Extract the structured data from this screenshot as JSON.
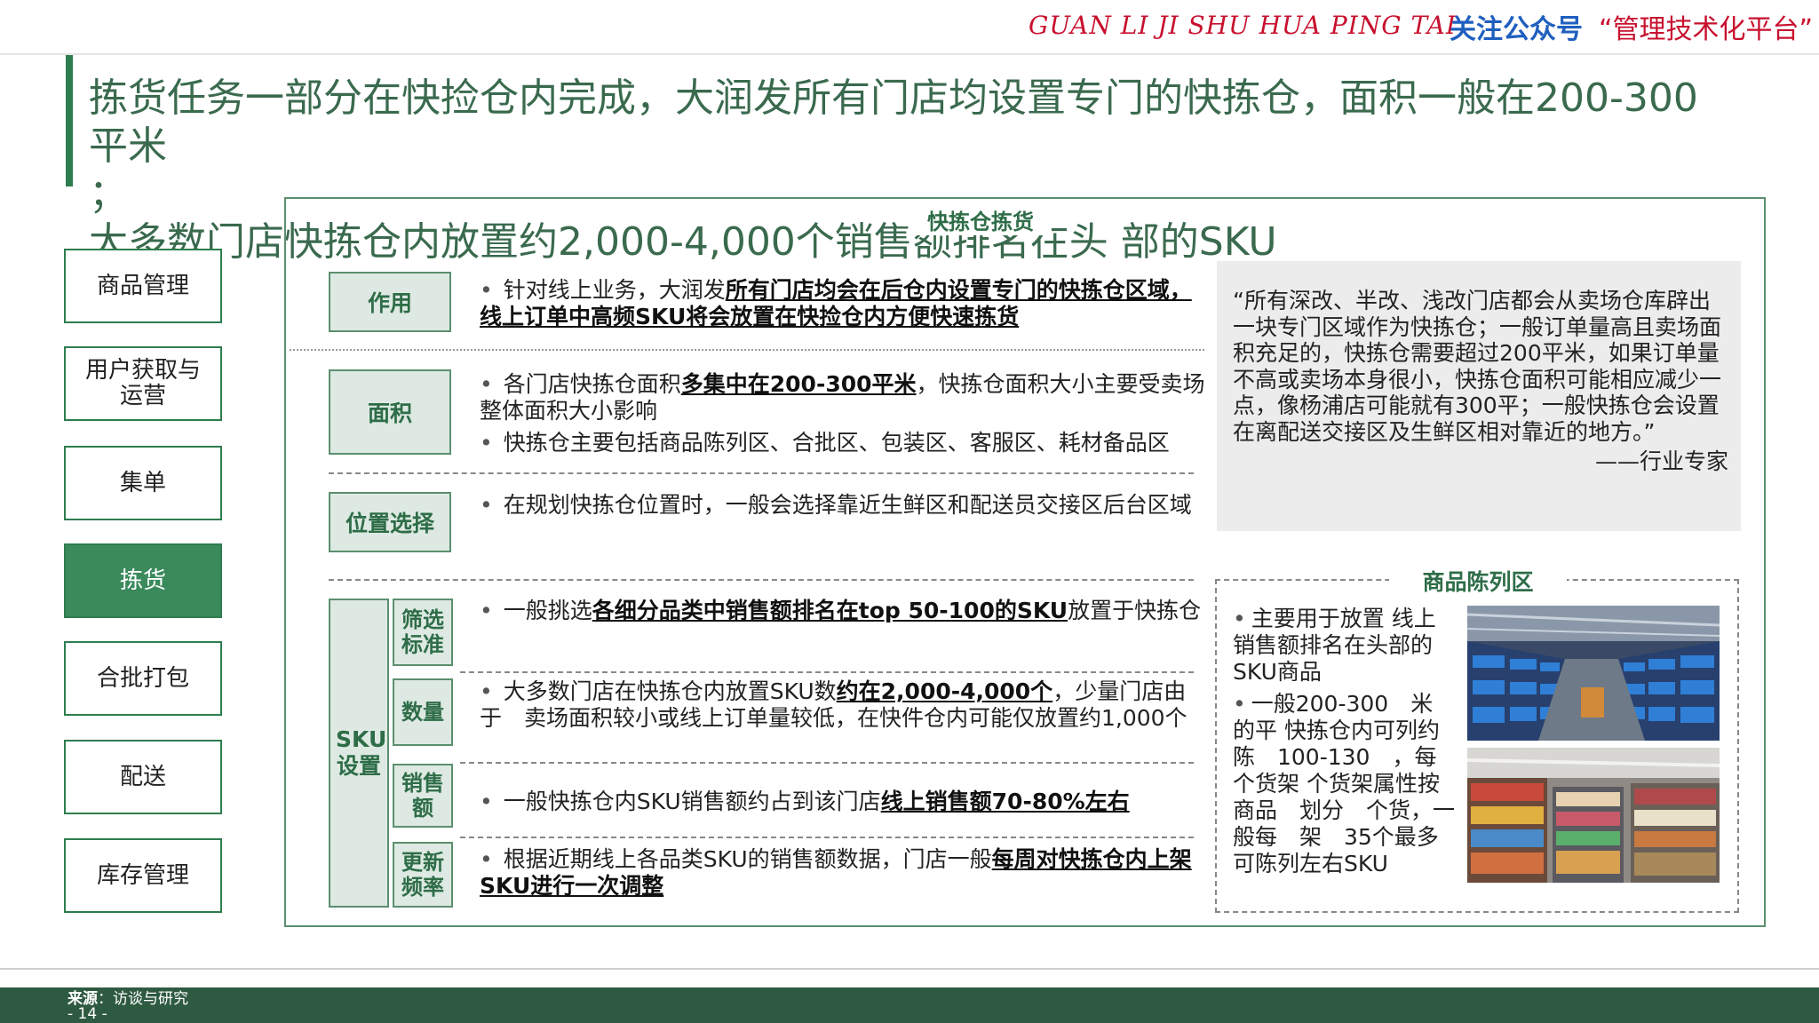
{
  "header": {
    "pinyin": "GUAN LI JI SHU HUA PING TAI",
    "follow_label": "关注公众号",
    "account_name": "“管理技术化平台”"
  },
  "title": {
    "line1": "拣货任务一部分在快捡仓内完成，大润发所有门店均设置专门的快拣仓，面积一般在200-300平米",
    "line2": "；",
    "line3": "大多数门店快拣仓内放置约2,000-4,000个销售额排名在头 部的SKU"
  },
  "sidebar": {
    "items": [
      {
        "label": "商品管理"
      },
      {
        "label": "用户获取与运营"
      },
      {
        "label": "集单"
      },
      {
        "label": "拣货"
      },
      {
        "label": "合批打包"
      },
      {
        "label": "配送"
      },
      {
        "label": "库存管理"
      }
    ],
    "active_index": 3
  },
  "panel": {
    "title": "快拣仓拣货",
    "sections": {
      "role": {
        "label": "作用",
        "b1_pre": "针对线上业务，大润发",
        "b1_bold": "所有门店均会在后仓内设置专门的快拣仓区域，线上订单中高频SKU将会放置在快捡仓内方便快速拣货"
      },
      "area": {
        "label": "面积",
        "b1_pre": "各门店快拣仓面积",
        "b1_bold": "多集中在200-300平米",
        "b1_post": "，快拣仓面积大小主要受卖场整体面积大小影响",
        "b2": "快拣仓主要包括商品陈列区、合批区、包装区、客服区、耗材备品区"
      },
      "location": {
        "label": "位置选择",
        "b1": "在规划快拣仓位置时，一般会选择靠近生鲜区和配送员交接区后台区域"
      },
      "sku": {
        "label": "SKU设置",
        "rows": [
          {
            "label": "筛选标准",
            "pre": "一般挑选",
            "bold": "各细分品类中销售额排名在top 50-100的SKU",
            "post": "放置于快拣仓"
          },
          {
            "label": "数量",
            "pre": "大多数门店在快拣仓内放置SKU数",
            "bold": "约在2,000-4,000个",
            "post": "，少量门店由于　卖场面积较小或线上订单量较低，在快件仓内可能仅放置约1,000个"
          },
          {
            "label": "销售额",
            "pre": "一般快拣仓内SKU销售额约占到该门店",
            "bold": "线上销售额70-80%左右",
            "post": ""
          },
          {
            "label": "更新频率",
            "pre": "根据近期线上各品类SKU的销售额数据，门店一般",
            "bold": "每周对快拣仓内上架SKU进行一次调整",
            "post": ""
          }
        ]
      }
    }
  },
  "quote": {
    "text": "“所有深改、半改、浅改门店都会从卖场仓库辟出一块专门区域作为快拣仓；一般订单量高且卖场面积充足的，快拣仓需要超过200平米，如果订单量不高或卖场本身很小，快拣仓面积可能相应减少一点，像杨浦店可能就有300平；一般快拣仓会设置在离配送交接区及生鲜区相对靠近的地方。”",
    "author": "——行业专家"
  },
  "display_area": {
    "title": "商品陈列区",
    "b1": "主要用于放置 线上销售额排名在头部的SKU商品",
    "b2": "一般200-300　米的平 快拣仓内可列约陈　100-130　，每个货架 个货架属性按商品　划分　个货，一般每　架　35个最多可陈列左右SKU"
  },
  "footer": {
    "source_label": "来源",
    "source_text": "：访谈与研究",
    "page": "- 14 -"
  },
  "colors": {
    "brand_green": "#2e7d4f",
    "label_fill": "#dde9e2",
    "footer_bar": "#2f5a42",
    "pinyin_red": "#c8102e",
    "follow_blue": "#1f5fbf"
  }
}
